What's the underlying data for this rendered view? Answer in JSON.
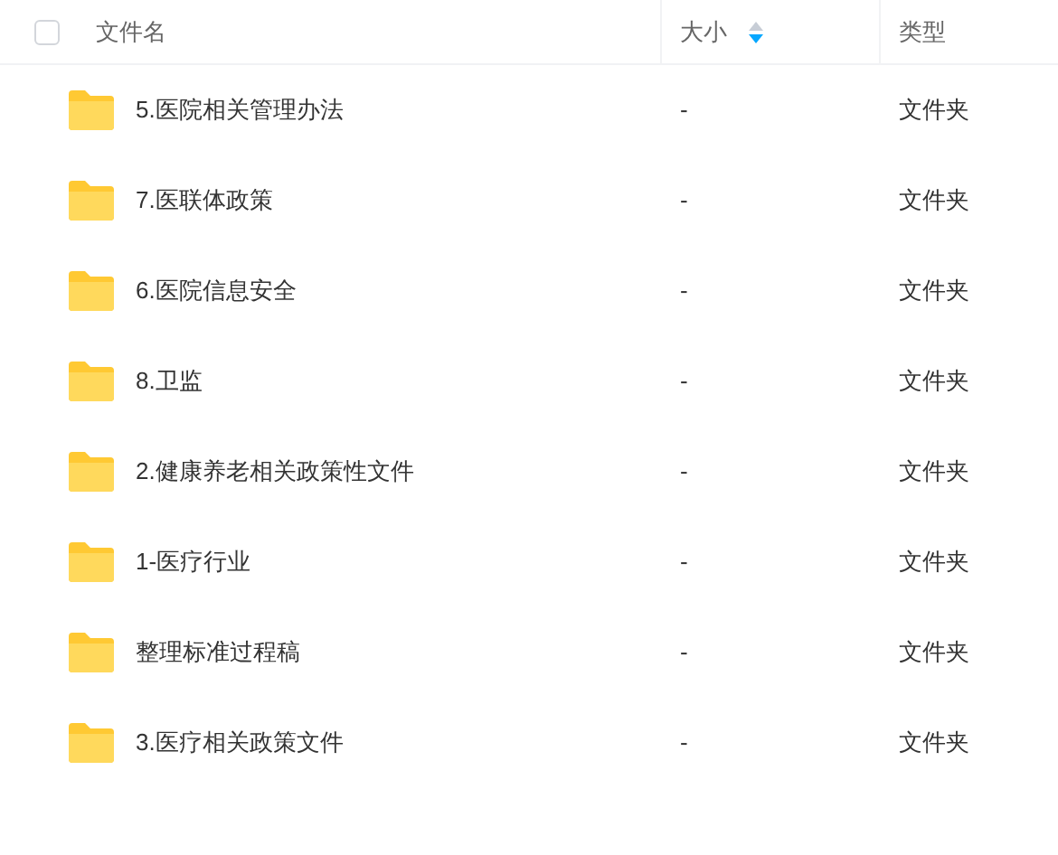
{
  "table": {
    "select_all": {
      "checked": false
    },
    "columns": [
      {
        "label": "文件名",
        "sorted": false
      },
      {
        "label": "大小",
        "sorted": true,
        "descending": true
      },
      {
        "label": "类型",
        "sorted": false
      }
    ],
    "rows": [
      {
        "name": "5.医院相关管理办法",
        "size": "-",
        "type": "文件夹"
      },
      {
        "name": "7.医联体政策",
        "size": "-",
        "type": "文件夹"
      },
      {
        "name": "6.医院信息安全",
        "size": "-",
        "type": "文件夹"
      },
      {
        "name": "8.卫监",
        "size": "-",
        "type": "文件夹"
      },
      {
        "name": "2.健康养老相关政策性文件",
        "size": "-",
        "type": "文件夹"
      },
      {
        "name": "1-医疗行业",
        "size": "-",
        "type": "文件夹"
      },
      {
        "name": "整理标准过程稿",
        "size": "-",
        "type": "文件夹"
      },
      {
        "name": "3.医疗相关政策文件",
        "size": "-",
        "type": "文件夹"
      }
    ]
  }
}
